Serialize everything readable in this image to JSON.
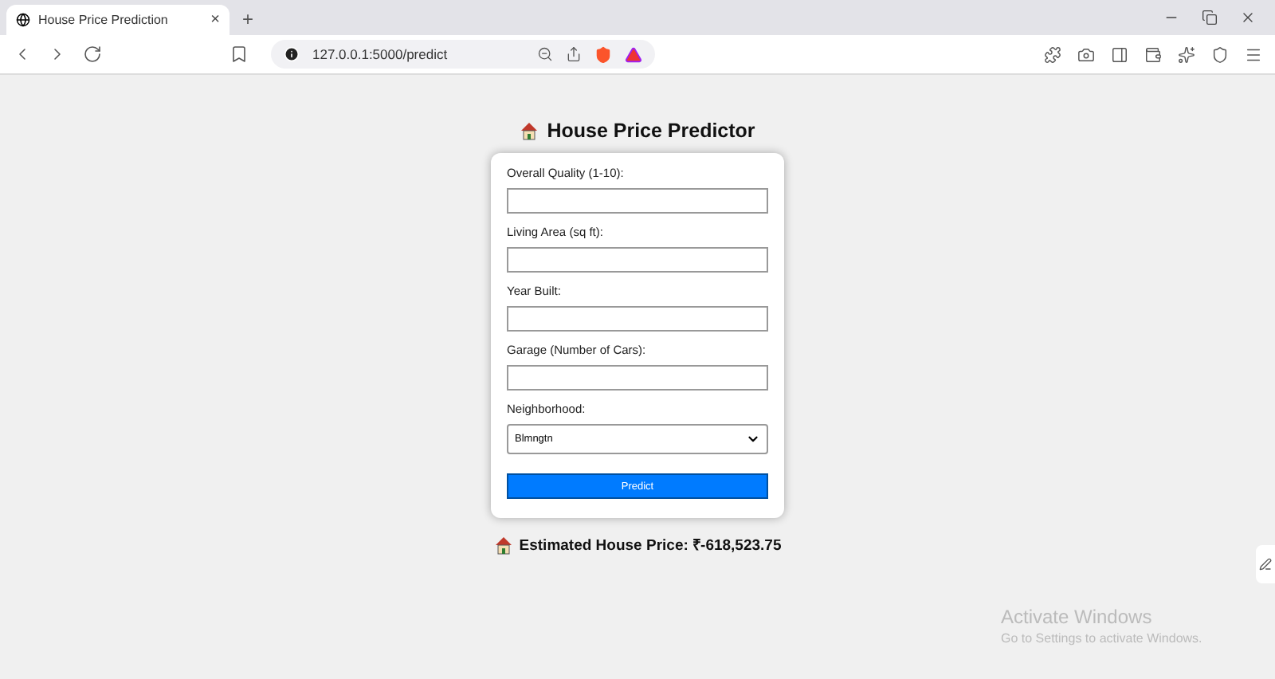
{
  "browser": {
    "tab": {
      "title": "House Price Prediction",
      "close": "×"
    },
    "new_tab": "+",
    "url": "127.0.0.1:5000/predict"
  },
  "page": {
    "title": "House Price Predictor",
    "fields": [
      {
        "label": "Overall Quality (1-10):",
        "kind": "input"
      },
      {
        "label": "Living Area (sq ft):",
        "kind": "input"
      },
      {
        "label": "Year Built:",
        "kind": "input"
      },
      {
        "label": "Garage (Number of Cars):",
        "kind": "input"
      },
      {
        "label": "Neighborhood:",
        "kind": "select",
        "value": "Blmngtn"
      }
    ],
    "button": "Predict",
    "result": "Estimated House Price: ₹-618,523.75"
  },
  "os_notice": {
    "title": "Activate Windows",
    "message": "Go to Settings to activate Windows."
  }
}
